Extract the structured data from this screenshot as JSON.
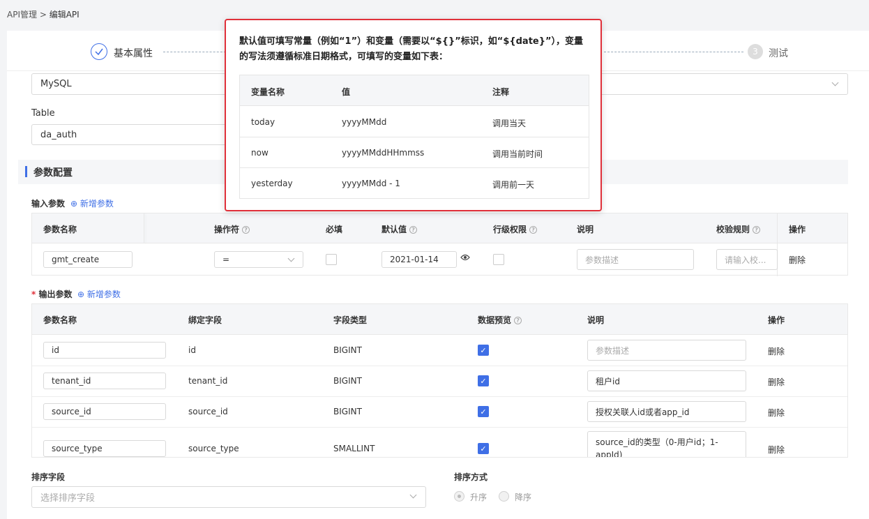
{
  "breadcrumb": {
    "parent": "API管理",
    "sep": ">",
    "current": "编辑API"
  },
  "steps": {
    "step1_label": "基本属性",
    "step3_num": "3",
    "step3_label": "测试"
  },
  "datasource": {
    "value": "MySQL"
  },
  "table": {
    "label": "Table",
    "value": "da_auth"
  },
  "section": {
    "title": "参数配置"
  },
  "input_params": {
    "title": "输入参数",
    "add_label": "新增参数",
    "headers": [
      "参数名称",
      "操作符",
      "必填",
      "默认值",
      "行级权限",
      "说明",
      "校验规则",
      "操作"
    ],
    "row": {
      "name": "gmt_create",
      "operator": "=",
      "default_value": "2021-01-14",
      "desc_placeholder": "参数描述",
      "rule_placeholder": "请输入校...",
      "action": "删除"
    }
  },
  "output_params": {
    "required_mark": "*",
    "title": "输出参数",
    "add_label": "新增参数",
    "headers": [
      "参数名称",
      "绑定字段",
      "字段类型",
      "数据预览",
      "说明",
      "操作"
    ],
    "rows": [
      {
        "name": "id",
        "field": "id",
        "type": "BIGINT",
        "desc": "",
        "desc_placeholder": "参数描述",
        "action": "删除"
      },
      {
        "name": "tenant_id",
        "field": "tenant_id",
        "type": "BIGINT",
        "desc": "租户id",
        "action": "删除"
      },
      {
        "name": "source_id",
        "field": "source_id",
        "type": "BIGINT",
        "desc": "授权关联人id或者app_id",
        "action": "删除"
      },
      {
        "name": "source_type",
        "field": "source_type",
        "type": "SMALLINT",
        "desc_line1": "source_id的类型（0-用户id；1-",
        "desc_line2": "appId)",
        "action": "删除"
      }
    ]
  },
  "sort": {
    "field_label": "排序字段",
    "field_placeholder": "选择排序字段",
    "order_label": "排序方式",
    "asc": "升序",
    "desc": "降序"
  },
  "popover": {
    "description_line1": "默认值可填写常量（例如“1”）和变量（需要以“${}”标识，如“${date}”），变量",
    "description_line2": "的写法须遵循标准日期格式，可填写的变量如下表：",
    "headers": [
      "变量名称",
      "值",
      "注释"
    ],
    "rows": [
      {
        "name": "today",
        "value": "yyyyMMdd",
        "note": "调用当天"
      },
      {
        "name": "now",
        "value": "yyyyMMddHHmmss",
        "note": "调用当前时间"
      },
      {
        "name": "yesterday",
        "value": "yyyyMMdd - 1",
        "note": "调用前一天"
      }
    ]
  },
  "colors": {
    "accent": "#3f6fe6",
    "highlight_border": "#e0303a"
  }
}
